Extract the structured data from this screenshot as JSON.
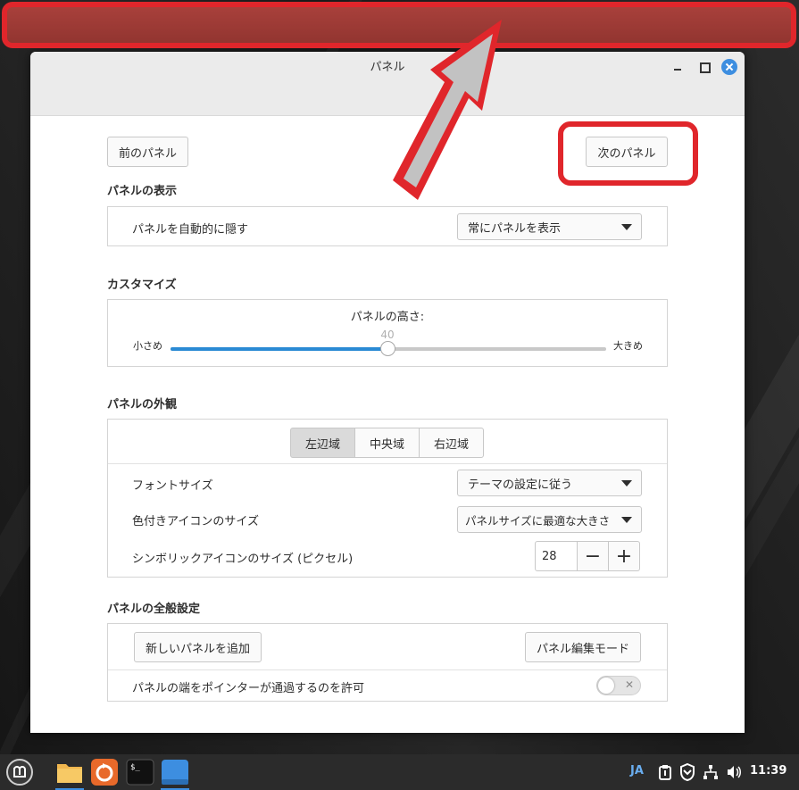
{
  "window": {
    "title": "パネル",
    "prev_panel": "前のパネル",
    "next_panel": "次のパネル"
  },
  "display": {
    "section_title": "パネルの表示",
    "autohide_label": "パネルを自動的に隠す",
    "autohide_value": "常にパネルを表示"
  },
  "customize": {
    "section_title": "カスタマイズ",
    "height_label": "パネルの高さ:",
    "small_label": "小さめ",
    "large_label": "大きめ",
    "height_value": "40",
    "height_fraction": 0.497
  },
  "appearance": {
    "section_title": "パネルの外観",
    "tabs": [
      "左辺域",
      "中央域",
      "右辺域"
    ],
    "active_tab": 0,
    "font_size_label": "フォントサイズ",
    "font_size_value": "テーマの設定に従う",
    "color_icon_label": "色付きアイコンのサイズ",
    "color_icon_value": "パネルサイズに最適な大きさ",
    "symbolic_icon_label": "シンボリックアイコンのサイズ (ピクセル)",
    "symbolic_icon_value": "28",
    "minus": "−",
    "plus": "+"
  },
  "general": {
    "section_title": "パネルの全般設定",
    "add_panel": "新しいパネルを追加",
    "edit_mode": "パネル編集モード",
    "pointer_pass_label": "パネルの端をポインターが通過するのを許可",
    "pointer_pass_enabled": false
  },
  "taskbar": {
    "lang": "JA",
    "time": "11:39"
  },
  "colors": {
    "accent": "#2a8ad4",
    "highlight": "#e0262b"
  }
}
